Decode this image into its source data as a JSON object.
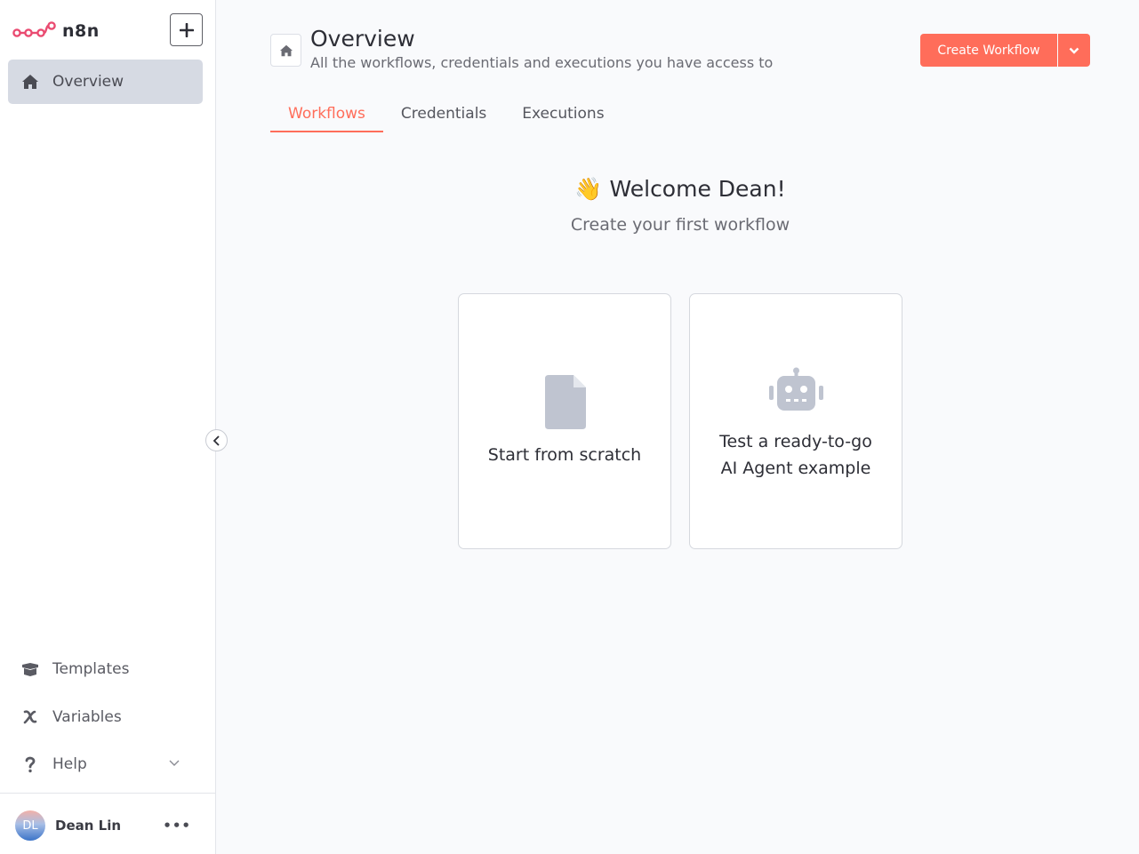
{
  "app": {
    "logo_text": "n8n"
  },
  "sidebar": {
    "overview_label": "Overview",
    "templates_label": "Templates",
    "variables_label": "Variables",
    "help_label": "Help",
    "user": {
      "initials": "DL",
      "name": "Dean Lin"
    }
  },
  "header": {
    "title": "Overview",
    "subtitle": "All the workflows, credentials and executions you have access to",
    "create_label": "Create Workflow"
  },
  "tabs": [
    {
      "label": "Workflows",
      "active": true
    },
    {
      "label": "Credentials",
      "active": false
    },
    {
      "label": "Executions",
      "active": false
    }
  ],
  "welcome": {
    "emoji": "👋",
    "title": "Welcome Dean!",
    "subtitle": "Create your first workflow"
  },
  "cards": {
    "scratch": {
      "label": "Start from scratch"
    },
    "agent": {
      "line1": "Test a ready-to-go",
      "line2": "AI Agent example"
    }
  },
  "colors": {
    "accent": "#ff6d5a",
    "active_nav_bg": "#d6dae3",
    "icon_gray": "#bfc4d0"
  }
}
